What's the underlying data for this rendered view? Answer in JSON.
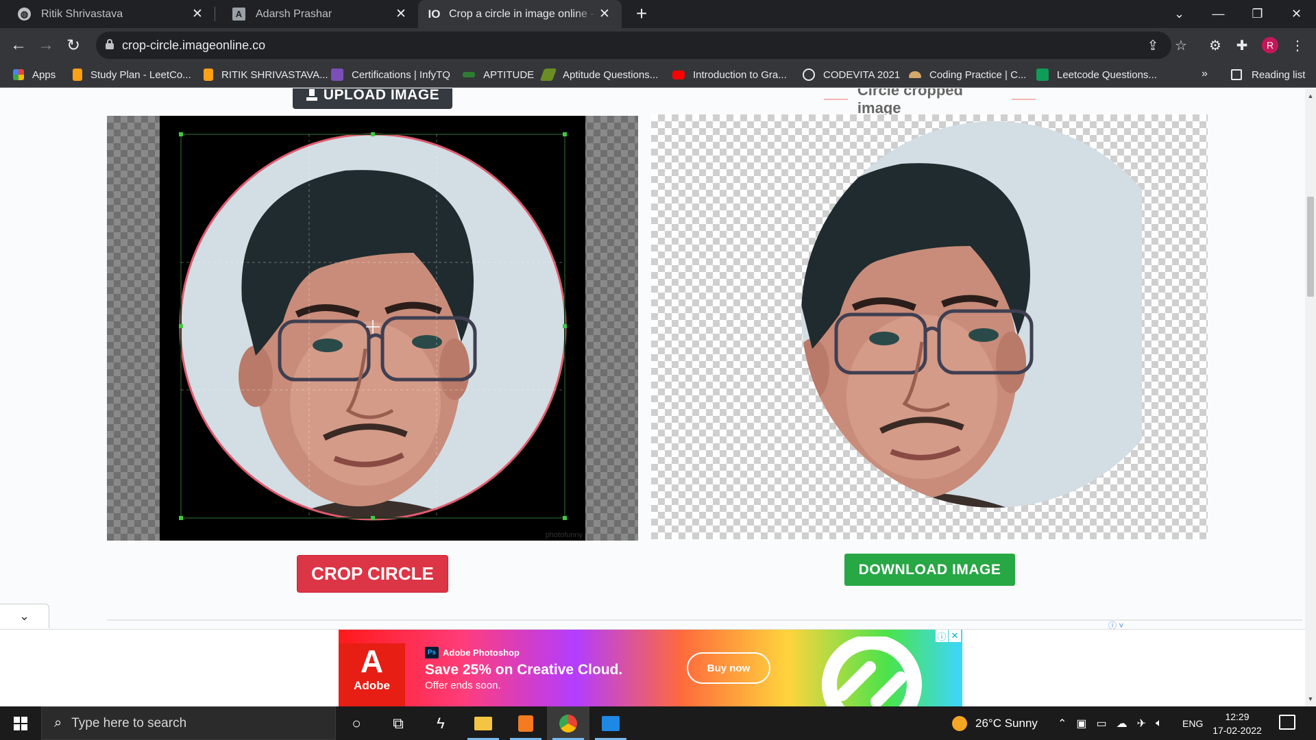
{
  "browser": {
    "tabs": [
      {
        "title": "Ritik Shrivastava",
        "favicon": "globe-icon",
        "active": false
      },
      {
        "title": "Adarsh Prashar",
        "favicon": "A",
        "active": false
      },
      {
        "title": "Crop a circle in image online - free",
        "favicon": "IO",
        "active": true
      }
    ],
    "url": "crop-circle.imageonline.co",
    "profile_initial": "R",
    "bookmarks": [
      {
        "label": "Apps",
        "icon": "apps-grid-icon",
        "color": "#4285f4"
      },
      {
        "label": "Study Plan - LeetCo...",
        "icon": "leetcode-icon",
        "color": "#ffa116"
      },
      {
        "label": "RITIK SHRIVASTAVA...",
        "icon": "leetcode-icon",
        "color": "#ffa116"
      },
      {
        "label": "Certifications | InfyTQ",
        "icon": "infytq-icon",
        "color": "#7b4fb8"
      },
      {
        "label": "APTITUDE",
        "icon": "aptitude-icon",
        "color": "#2e7d32"
      },
      {
        "label": "Aptitude Questions...",
        "icon": "indiabix-icon",
        "color": "#6a8e23"
      },
      {
        "label": "Introduction to Gra...",
        "icon": "youtube-icon",
        "color": "#ff0000"
      },
      {
        "label": "CODEVITA 2021",
        "icon": "globe-icon",
        "color": "#e8eaed"
      },
      {
        "label": "Coding Practice | C...",
        "icon": "codechef-icon",
        "color": "#d4a76a"
      },
      {
        "label": "Leetcode Questions...",
        "icon": "sheets-icon",
        "color": "#0f9d58"
      }
    ],
    "more_bookmarks": "»",
    "reading_list": "Reading list"
  },
  "page": {
    "upload_label": "UPLOAD IMAGE",
    "result_title": "Circle cropped image",
    "crop_label": "CROP CIRCLE",
    "download_label": "DOWNLOAD IMAGE",
    "watermark": "photofunny",
    "colors": {
      "crop": "#dc3545",
      "download": "#28a745",
      "upload": "#343a40",
      "crop_outline": "#e05a6e",
      "handle": "#3fc93f"
    }
  },
  "ad": {
    "brand": "Adobe",
    "product": "Adobe Photoshop",
    "headline": "Save 25% on Creative Cloud.",
    "subline": "Offer ends soon.",
    "cta": "Buy now"
  },
  "taskbar": {
    "search_placeholder": "Type here to search",
    "weather": "26°C  Sunny",
    "language": "ENG",
    "time": "12:29",
    "date": "17-02-2022"
  }
}
